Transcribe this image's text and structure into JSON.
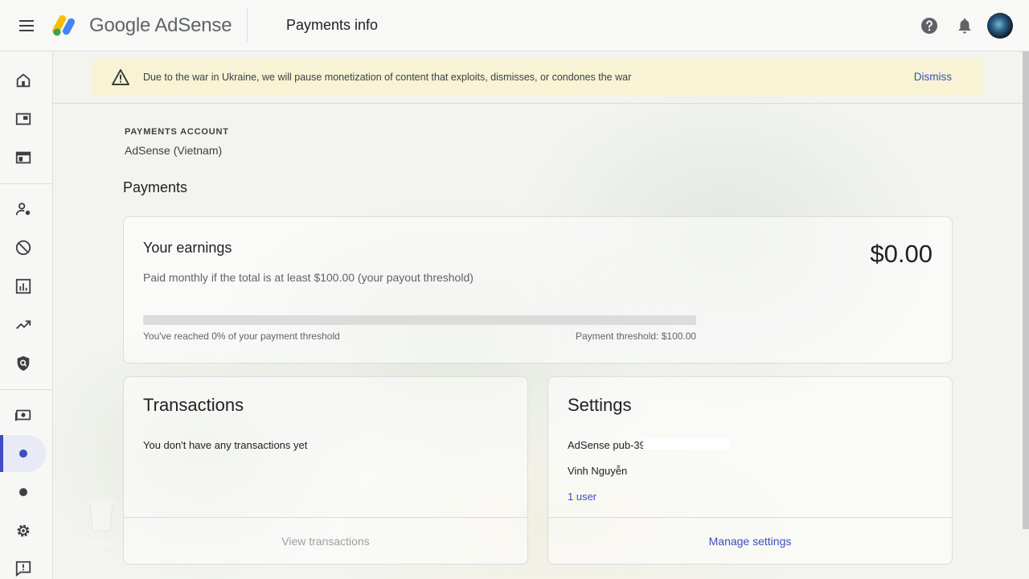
{
  "header": {
    "brand": "Google AdSense",
    "page_title": "Payments info"
  },
  "banner": {
    "message": "Due to the war in Ukraine, we will pause monetization of content that exploits, dismisses, or condones the war",
    "dismiss_label": "Dismiss"
  },
  "account": {
    "label": "PAYMENTS ACCOUNT",
    "name": "AdSense (Vietnam)"
  },
  "payments": {
    "section_title": "Payments",
    "earnings": {
      "title": "Your earnings",
      "amount": "$0.00",
      "subtitle": "Paid monthly if the total is at least $100.00 (your payout threshold)",
      "progress_fraction": 0,
      "progress_text": "You've reached 0% of your payment threshold",
      "threshold_text": "Payment threshold: $100.00"
    },
    "transactions": {
      "title": "Transactions",
      "empty_text": "You don't have any transactions yet",
      "action_label": "View transactions"
    },
    "settings": {
      "title": "Settings",
      "publisher_id": "AdSense pub-39",
      "owner_name": "Vinh Nguyễn",
      "users_link": "1 user",
      "action_label": "Manage settings"
    }
  },
  "desktop": {
    "trash_label": "Trash"
  },
  "colors": {
    "accent": "#3c4ec2",
    "banner_bg": "#f8f3d4",
    "progress_track": "#dcdcdc"
  }
}
